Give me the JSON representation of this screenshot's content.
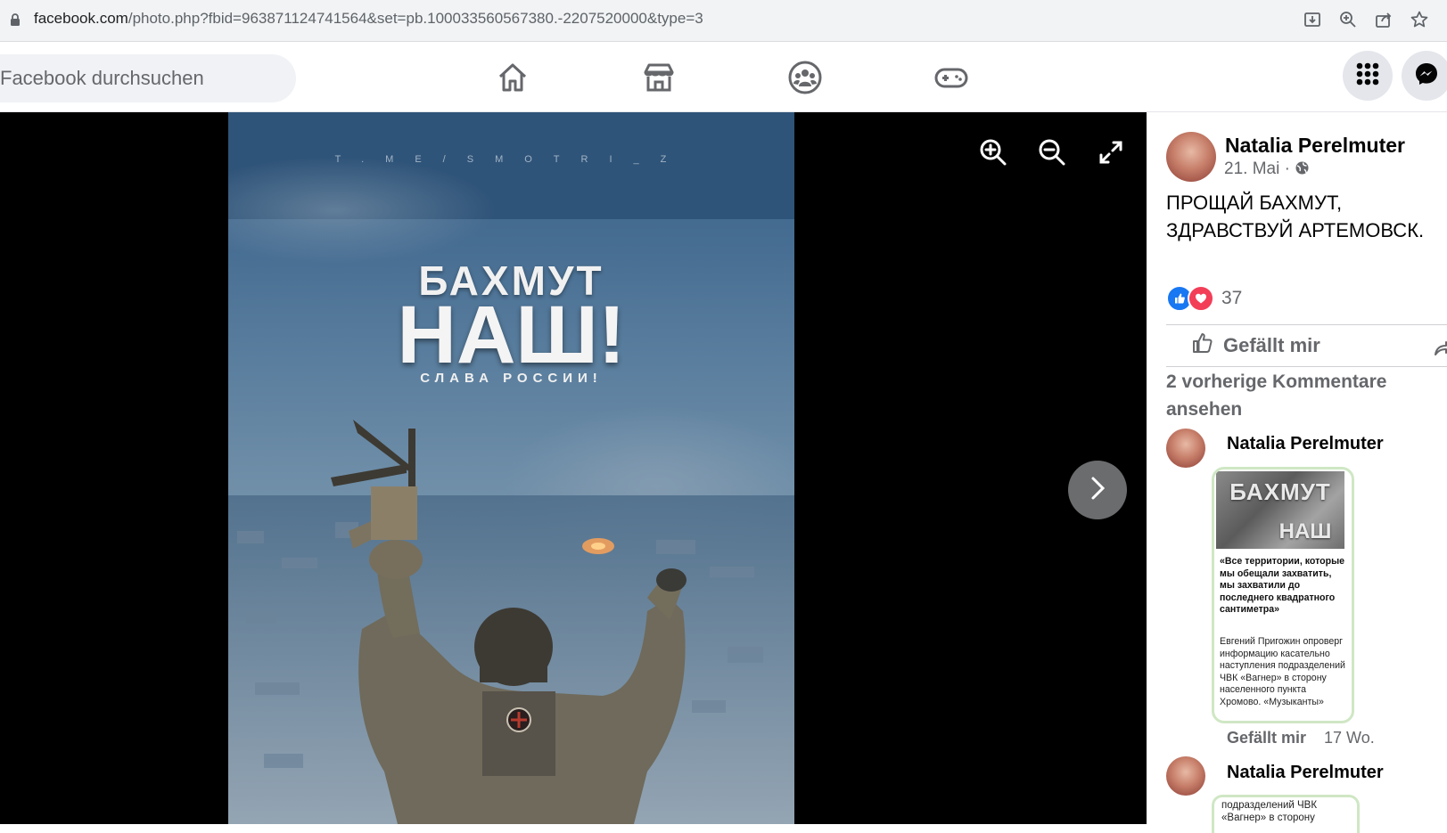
{
  "browser": {
    "url_host": "facebook.com",
    "url_path": "/photo.php?fbid=963871124741564&set=pb.100033560567380.-2207520000&type=3"
  },
  "header": {
    "search_placeholder": "Facebook durchsuchen"
  },
  "poster": {
    "watermark": "T.ME/SMOTRI_Z",
    "line1": "БАХМУТ",
    "line2": "НАШ!",
    "line3": "СЛАВА РОССИИ!"
  },
  "post": {
    "author": "Natalia Perelmuter",
    "date": "21. Mai ·",
    "text_line1": "ПРОЩАЙ БАХМУТ,",
    "text_line2": "ЗДРАВСТВУЙ АРТЕМОВСК.",
    "reaction_count": "37",
    "like_label": "Gefällt mir",
    "previous_comments": "2 vorherige Kommentare ansehen"
  },
  "comments": [
    {
      "author": "Natalia Perelmuter",
      "image_title_top": "БАХМУТ",
      "image_title_bottom": "НАШ",
      "quote": "«Все территории, которые мы обещали захватить, мы захватили до последнего квадратного сантиметра»",
      "body": "Евгений Пригожин опроверг информацию касательно наступления подразделений ЧВК «Вагнер» в сторону населенного пункта Хромово. «Музыканты»",
      "like_label": "Gefällt mir",
      "time": "17 Wo."
    },
    {
      "author": "Natalia Perelmuter",
      "body": "подразделений ЧВК «Вагнер» в сторону"
    }
  ],
  "colors": {
    "brand": "#1877f2",
    "love": "#f33e58",
    "muted_text": "#65676b",
    "viewer_bg": "#000000"
  }
}
